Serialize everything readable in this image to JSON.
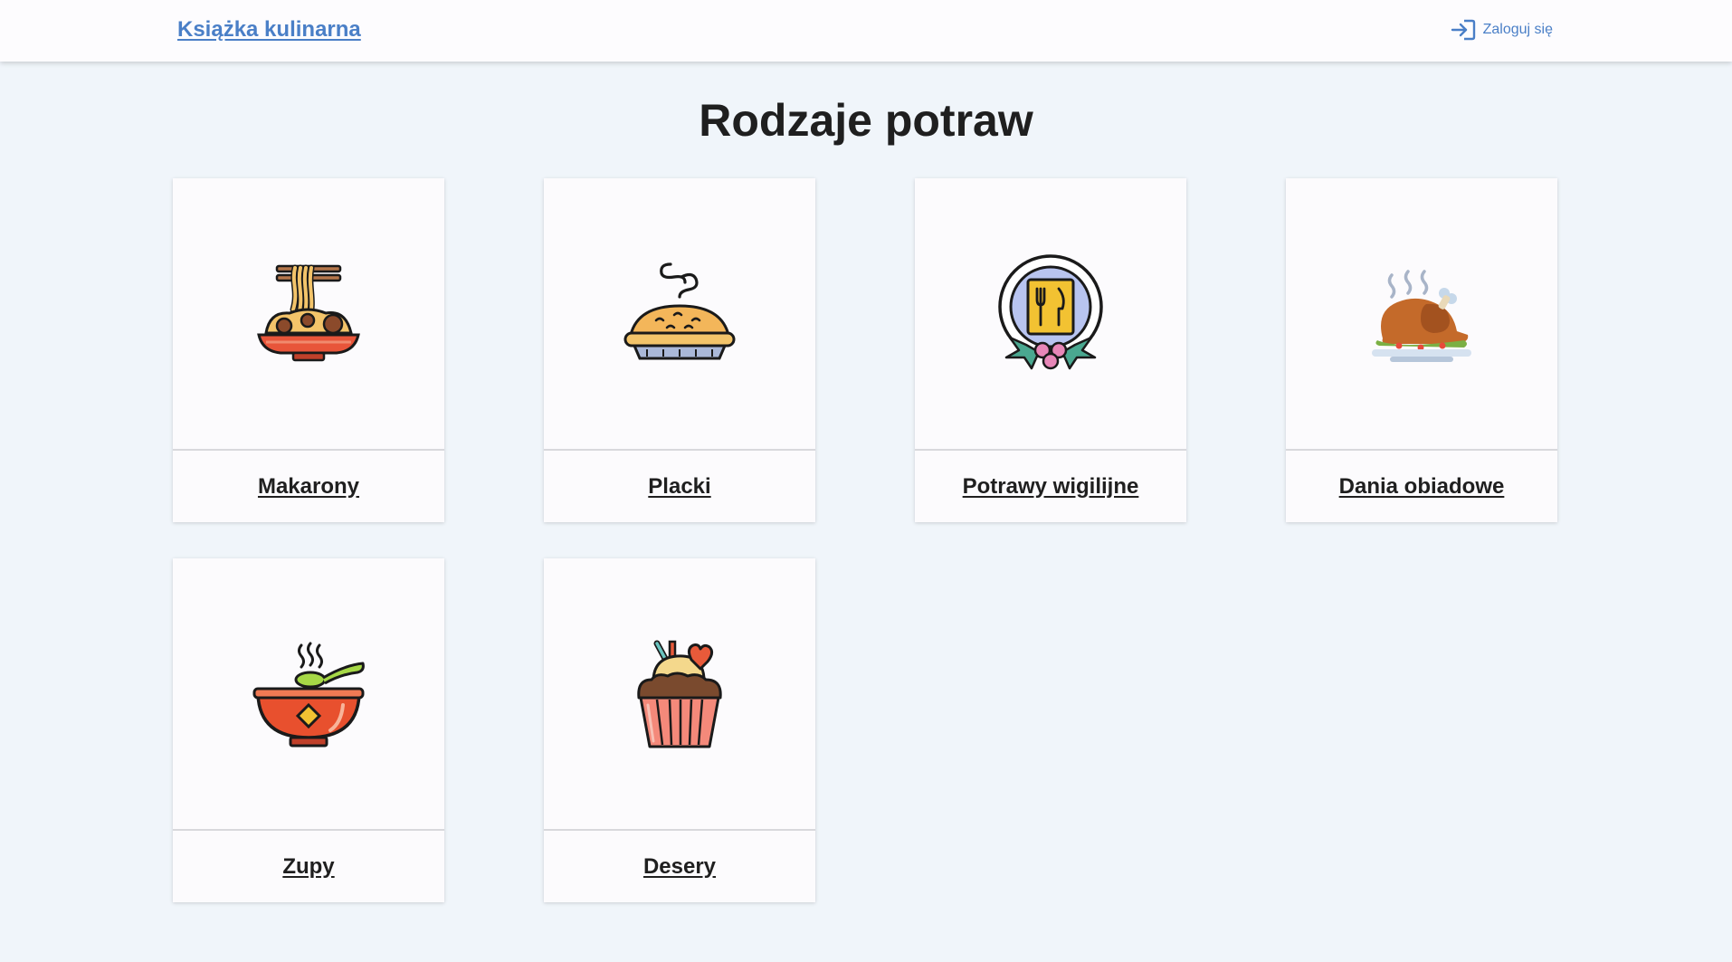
{
  "header": {
    "brand": "Książka kulinarna",
    "login_label": "Zaloguj się",
    "login_icon": "login-icon",
    "accent": "#4a7fc7"
  },
  "main": {
    "title": "Rodzaje potraw",
    "categories": [
      {
        "label": "Makarony",
        "icon": "noodles-icon"
      },
      {
        "label": "Placki",
        "icon": "pie-icon"
      },
      {
        "label": "Potrawy wigilijne",
        "icon": "christmas-plate-icon"
      },
      {
        "label": "Dania obiadowe",
        "icon": "roast-chicken-icon"
      },
      {
        "label": "Zupy",
        "icon": "soup-bowl-icon"
      },
      {
        "label": "Desery",
        "icon": "cupcake-icon"
      }
    ]
  }
}
